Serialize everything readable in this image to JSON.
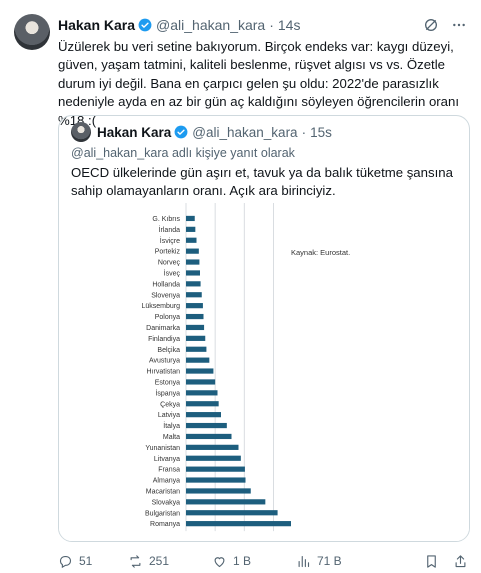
{
  "tweet": {
    "author_name": "Hakan Kara",
    "author_handle": "@ali_hakan_kara",
    "time": "14s",
    "text": "Üzülerek bu veri setine bakıyorum. Birçok endeks var: kaygı düzeyi, güven, yaşam tatmini, kaliteli beslenme, rüşvet algısı vs vs. Özetle durum iyi değil. Bana en çarpıcı gelen şu oldu: 2022'de parasızlık nedeniyle ayda en az bir gün aç kaldığını söyleyen öğrencilerin oranı %18 :("
  },
  "quote": {
    "author_name": "Hakan Kara",
    "author_handle": "@ali_hakan_kara",
    "time": "15s",
    "reply_to": "@ali_hakan_kara adlı kişiye yanıt olarak",
    "text": "OECD ülkelerinde gün aşırı et, tavuk ya da balık tüketme şansına sahip olamayanların oranı. Açık ara birinciyiz."
  },
  "chart_data": {
    "type": "bar",
    "orientation": "horizontal",
    "annotation": "Kaynak: Eurostat.",
    "categories": [
      "G. Kıbrıs",
      "İrlanda",
      "İsviçre",
      "Portekiz",
      "Norveç",
      "İsveç",
      "Hollanda",
      "Slovenya",
      "Lüksemburg",
      "Polonya",
      "Danimarka",
      "Finlandiya",
      "Belçika",
      "Avusturya",
      "Hırvatistan",
      "Estonya",
      "İspanya",
      "Çekya",
      "Latviya",
      "İtalya",
      "Malta",
      "Yunanistan",
      "Litvanya",
      "Fransa",
      "Almanya",
      "Macaristan",
      "Slovakya",
      "Bulgaristan",
      "Romanya"
    ],
    "values": [
      1.5,
      1.6,
      1.8,
      2.2,
      2.3,
      2.4,
      2.5,
      2.7,
      2.9,
      3.0,
      3.1,
      3.3,
      3.5,
      4.0,
      4.7,
      5.0,
      5.4,
      5.6,
      6.0,
      7.0,
      7.8,
      9.0,
      9.4,
      10.1,
      10.2,
      11.1,
      13.6,
      15.7,
      18.0
    ],
    "xlim": [
      0,
      18
    ]
  },
  "actions": {
    "replies": "51",
    "reposts": "251",
    "likes": "1 B",
    "views": "71 B"
  },
  "icons": {
    "verified": "verified-badge-icon",
    "grok": "grok-icon",
    "more": "more-icon",
    "reply": "reply-icon",
    "repost": "repost-icon",
    "like": "like-icon",
    "views": "views-icon",
    "bookmark": "bookmark-icon",
    "share": "share-icon"
  },
  "colors": {
    "bar": "#1d5e7e",
    "verified": "#1d9bf0",
    "muted": "#536471"
  }
}
